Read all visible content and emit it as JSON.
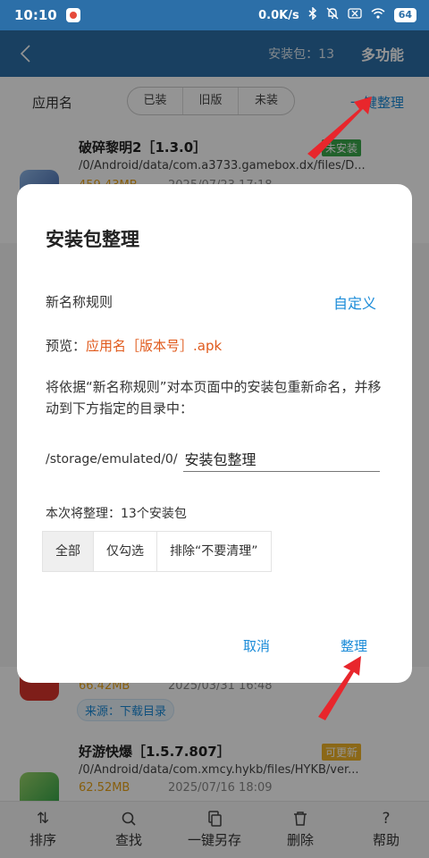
{
  "status": {
    "time": "10:10",
    "speed": "0.0K/s",
    "battery": "64"
  },
  "header": {
    "back_icon": "chevron-left-icon",
    "package_count": "安装包：13",
    "multi_function": "多功能"
  },
  "filter": {
    "column_label": "应用名",
    "segments": [
      "已装",
      "旧版",
      "未装"
    ],
    "tidy_all": "一键整理"
  },
  "list": [
    {
      "title": "破碎黎明2［1.3.0］",
      "tag": "未安装",
      "path": "/0/Android/data/com.a3733.gamebox.dx/files/D...",
      "size": "459.43MB",
      "date": "2025/07/23 17:18"
    },
    {
      "size": "66.42MB",
      "date": "2025/03/31 16:48",
      "source": "来源：下载目录"
    },
    {
      "title": "好游快爆［1.5.7.807］",
      "tag": "可更新",
      "path": "/0/Android/data/com.xmcy.hykb/files/HYKB/ver...",
      "size": "62.52MB",
      "date": "2025/07/16 18:09"
    }
  ],
  "bottom_nav": [
    {
      "label": "排序",
      "icon": "sort-icon"
    },
    {
      "label": "查找",
      "icon": "search-icon"
    },
    {
      "label": "一键另存",
      "icon": "copy-icon"
    },
    {
      "label": "删除",
      "icon": "trash-icon"
    },
    {
      "label": "帮助",
      "icon": "help-icon"
    }
  ],
  "dialog": {
    "title": "安装包整理",
    "rule_label": "新名称规则",
    "custom": "自定义",
    "preview_label": "预览：",
    "preview_value": "应用名［版本号］.apk",
    "description": "将依据“新名称规则”对本页面中的安装包重新命名，并移动到下方指定的目录中：",
    "dir_prefix": "/storage/emulated/0/",
    "dir_value": "安装包整理",
    "summary": "本次将整理：13个安装包",
    "scope_options": [
      "全部",
      "仅勾选",
      "排除“不要清理”"
    ],
    "scope_selected": "全部",
    "cancel": "取消",
    "confirm": "整理"
  },
  "colors": {
    "primary": "#2c6fa8",
    "accent": "#1a8bd8",
    "preview": "#e05a1c",
    "size": "#e8a317",
    "arrow": "#e8262c"
  }
}
